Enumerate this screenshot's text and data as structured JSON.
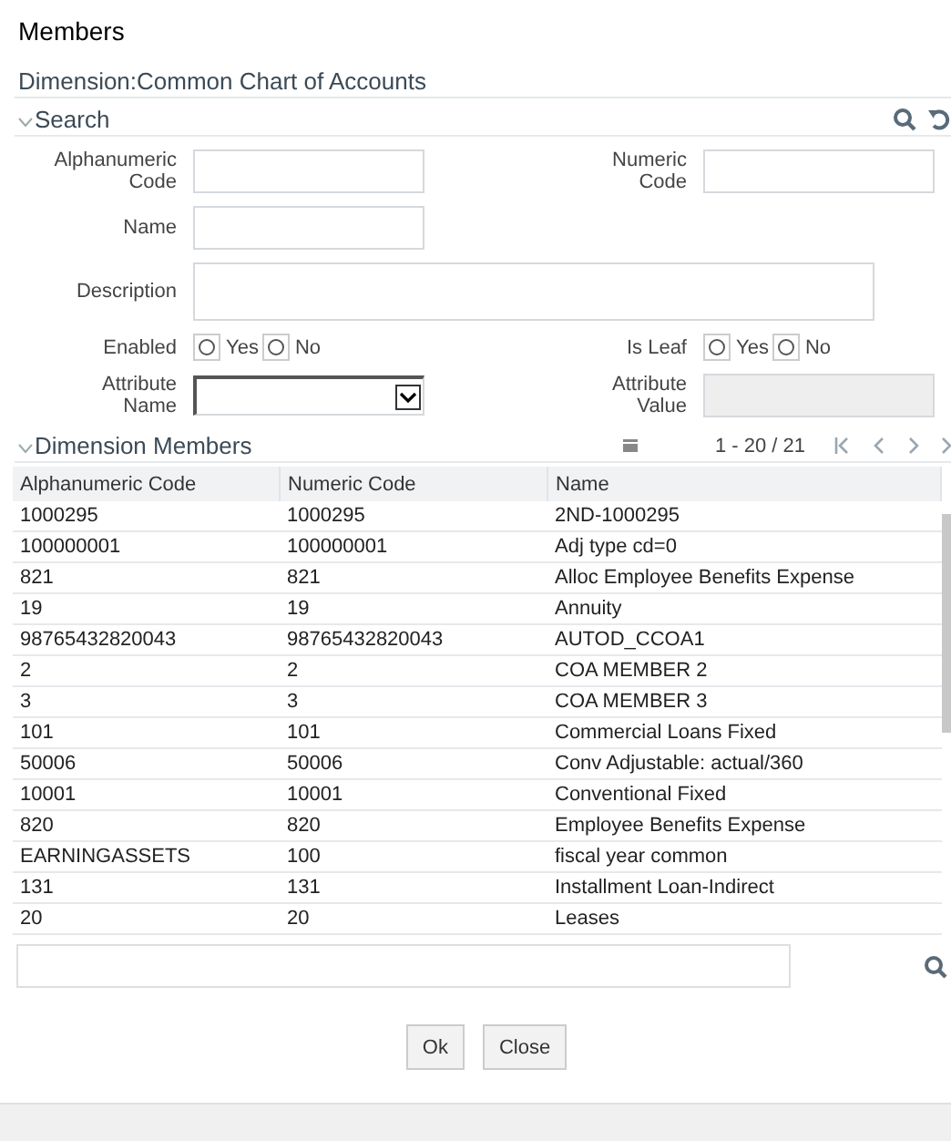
{
  "dialog": {
    "title": "Members",
    "subtitle": "Dimension:Common Chart of Accounts"
  },
  "search": {
    "title": "Search",
    "expanded": true,
    "fields": [
      {
        "kind": "text",
        "label": "Alphanumeric Code"
      },
      {
        "kind": "text",
        "label": "Numeric Code"
      },
      {
        "kind": "text",
        "label": "Name"
      },
      {
        "kind": "blank"
      },
      {
        "kind": "textarea",
        "label": "Description"
      },
      {
        "kind": "radio",
        "label": "Enabled",
        "options": [
          {
            "label": "Yes",
            "selected": false
          },
          {
            "label": "No",
            "selected": false
          }
        ]
      },
      {
        "kind": "radio",
        "label": "Is Leaf",
        "options": [
          {
            "label": "Yes",
            "selected": false
          },
          {
            "label": "No",
            "selected": false
          }
        ]
      },
      {
        "kind": "select",
        "label": "Attribute Name"
      },
      {
        "kind": "disabled",
        "label": "Attribute Value"
      }
    ]
  },
  "members": {
    "title": "Dimension Members",
    "expanded": true,
    "range": "1 - 20 / 21",
    "columns": [
      "Alphanumeric Code",
      "Numeric Code",
      "Name"
    ],
    "rows": [
      [
        "1000295",
        "1000295",
        "2ND-1000295"
      ],
      [
        "100000001",
        "100000001",
        "Adj type cd=0"
      ],
      [
        "821",
        "821",
        "Alloc Employee Benefits Expense"
      ],
      [
        "19",
        "19",
        "Annuity"
      ],
      [
        "98765432820043",
        "98765432820043",
        "AUTOD_CCOA1"
      ],
      [
        "2",
        "2",
        "COA MEMBER 2"
      ],
      [
        "3",
        "3",
        "COA MEMBER 3"
      ],
      [
        "101",
        "101",
        "Commercial Loans Fixed"
      ],
      [
        "50006",
        "50006",
        "Conv Adjustable: actual/360"
      ],
      [
        "10001",
        "10001",
        "Conventional Fixed"
      ],
      [
        "820",
        "820",
        "Employee Benefits Expense"
      ],
      [
        "EARNINGASSETS",
        "100",
        "fiscal year common"
      ],
      [
        "131",
        "131",
        "Installment Loan-Indirect"
      ],
      [
        "20",
        "20",
        "Leases"
      ]
    ]
  },
  "buttons": [
    "Ok",
    "Close"
  ]
}
